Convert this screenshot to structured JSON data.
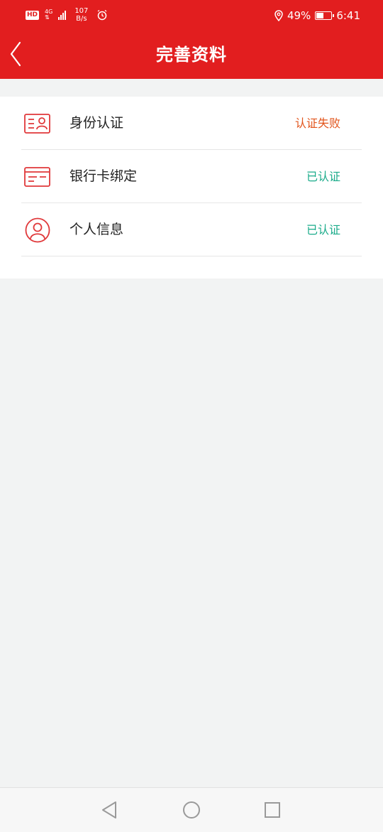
{
  "status_bar": {
    "hd": "HD",
    "network": "4G",
    "speed_value": "107",
    "speed_unit": "B/s",
    "battery": "49%",
    "time": "6:41"
  },
  "header": {
    "title": "完善资料",
    "back_icon": "back-chevron-icon"
  },
  "items": [
    {
      "label": "身份认证",
      "status": "认证失败",
      "status_color": "#e2541b",
      "icon": "id-card-icon"
    },
    {
      "label": "银行卡绑定",
      "status": "已认证",
      "status_color": "#1aab8a",
      "icon": "bank-card-icon"
    },
    {
      "label": "个人信息",
      "status": "已认证",
      "status_color": "#1aab8a",
      "icon": "user-circle-icon"
    }
  ],
  "colors": {
    "brand": "#e21e1f",
    "icon": "#e0383a",
    "background": "#f2f3f3"
  },
  "system_nav": {
    "back_icon": "nav-back-icon",
    "home_icon": "nav-home-icon",
    "recent_icon": "nav-recent-icon"
  }
}
